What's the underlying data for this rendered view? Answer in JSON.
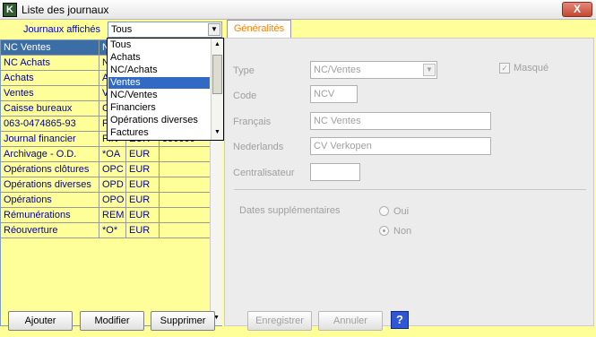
{
  "window": {
    "title": "Liste des journaux",
    "close_label": "X"
  },
  "filter": {
    "label": "Journaux affichés",
    "selected": "Tous",
    "options": [
      "Tous",
      "Achats",
      "NC/Achats",
      "Ventes",
      "NC/Ventes",
      "Financiers",
      "Opérations diverses",
      "Factures"
    ],
    "highlighted_index": 3
  },
  "journals": [
    {
      "name": "NC Ventes",
      "code": "N",
      "currency": "",
      "extra": "",
      "selected": true
    },
    {
      "name": "NC Achats",
      "code": "N",
      "currency": "",
      "extra": ""
    },
    {
      "name": "Achats",
      "code": "A",
      "currency": "",
      "extra": ""
    },
    {
      "name": "Ventes",
      "code": "V",
      "currency": "",
      "extra": ""
    },
    {
      "name": "Caisse bureaux",
      "code": "C",
      "currency": "",
      "extra": ""
    },
    {
      "name": "063-0474865-93",
      "code": "F",
      "currency": "",
      "extra": ""
    },
    {
      "name": "Journal financier",
      "code": "FIN",
      "currency": "EUR",
      "extra": "550000"
    },
    {
      "name": "Archivage - O.D.",
      "code": "*OA",
      "currency": "EUR",
      "extra": ""
    },
    {
      "name": "Opérations clôtures",
      "code": "OPC",
      "currency": "EUR",
      "extra": ""
    },
    {
      "name": "Opérations diverses",
      "code": "OPD",
      "currency": "EUR",
      "extra": ""
    },
    {
      "name": "Opérations",
      "code": "OPO",
      "currency": "EUR",
      "extra": ""
    },
    {
      "name": "Rémunérations",
      "code": "REM",
      "currency": "EUR",
      "extra": ""
    },
    {
      "name": "Réouverture",
      "code": "*O*",
      "currency": "EUR",
      "extra": ""
    }
  ],
  "tab": {
    "label": "Généralités"
  },
  "form": {
    "type_label": "Type",
    "type_value": "NC/Ventes",
    "masque_label": "Masqué",
    "masque_checked": true,
    "code_label": "Code",
    "code_value": "NCV",
    "francais_label": "Français",
    "francais_value": "NC Ventes",
    "nederlands_label": "Nederlands",
    "nederlands_value": "CV Verkopen",
    "centralisateur_label": "Centralisateur",
    "centralisateur_value": "",
    "dates_label": "Dates supplémentaires",
    "oui_label": "Oui",
    "non_label": "Non",
    "dates_selected": "Non"
  },
  "buttons": {
    "ajouter": "Ajouter",
    "modifier": "Modifier",
    "supprimer": "Supprimer",
    "enregistrer": "Enregistrer",
    "annuler": "Annuler",
    "help": "?"
  }
}
